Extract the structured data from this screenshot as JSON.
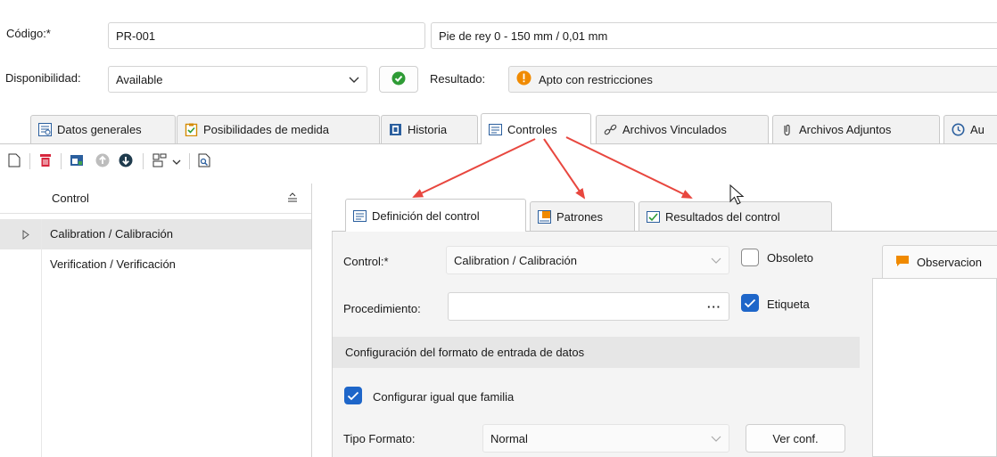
{
  "header": {
    "codigo_label": "Código:*",
    "codigo_value": "PR-001",
    "description_value": "Pie de rey 0 - 150 mm / 0,01 mm",
    "disponibilidad_label": "Disponibilidad:",
    "disponibilidad_value": "Available",
    "resultado_label": "Resultado:",
    "resultado_value": "Apto con restricciones"
  },
  "main_tabs": [
    {
      "label": "Datos generales",
      "icon": "general-data-icon"
    },
    {
      "label": "Posibilidades de medida",
      "icon": "clipboard-check-icon"
    },
    {
      "label": "Historia",
      "icon": "history-book-icon"
    },
    {
      "label": "Controles",
      "icon": "controls-icon",
      "active": true
    },
    {
      "label": "Archivos Vinculados",
      "icon": "link-icon"
    },
    {
      "label": "Archivos Adjuntos",
      "icon": "paperclip-icon"
    },
    {
      "label": "Au",
      "icon": "audit-clock-icon"
    }
  ],
  "toolbar": {
    "icons": [
      "new-document-icon",
      "delete-icon",
      "window-icon",
      "up-circle-icon",
      "down-circle-icon",
      "layout-icon",
      "chevron-down-icon",
      "preview-icon"
    ]
  },
  "list": {
    "column_header": "Control",
    "items": [
      "Calibration / Calibración",
      "Verification / Verificación"
    ]
  },
  "inner_tabs": [
    {
      "label": "Definición del control",
      "icon": "definition-icon",
      "active": true
    },
    {
      "label": "Patrones",
      "icon": "patterns-icon"
    },
    {
      "label": "Resultados del control",
      "icon": "results-icon"
    }
  ],
  "form": {
    "control_label": "Control:*",
    "control_value": "Calibration / Calibración",
    "obsoleto_label": "Obsoleto",
    "procedimiento_label": "Procedimiento:",
    "procedimiento_value": "",
    "ellipsis": "···",
    "etiqueta_label": "Etiqueta",
    "section_title": "Configuración del formato de entrada de datos",
    "configurar_label": "Configurar igual que familia",
    "tipo_formato_label": "Tipo Formato:",
    "tipo_formato_value": "Normal",
    "ver_conf_label": "Ver conf."
  },
  "right_panel": {
    "tab_label": "Observacion"
  },
  "colors": {
    "accent_blue": "#1e66c9",
    "green_ok": "#2e9b35",
    "warning_orange": "#f08a00",
    "annotation_red": "#e8473f",
    "selected_row": "#e6e6e6"
  }
}
